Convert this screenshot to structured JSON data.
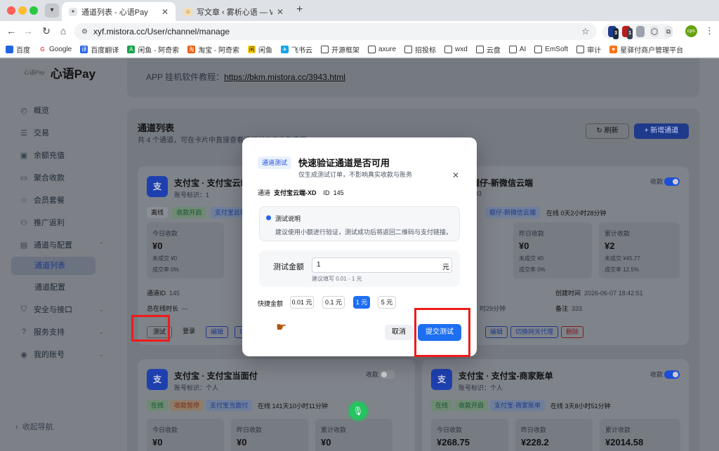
{
  "browser": {
    "tabs": [
      {
        "title": "通道列表 - 心语Pay",
        "active": true
      },
      {
        "title": "写文章 ‹ 雾析心语 — WordPress",
        "active": false
      }
    ],
    "url": "xyf.mistora.cc/User/channel/manage",
    "bookmarks": [
      "百度",
      "Google",
      "百度翻译",
      "闲鱼 - 阿奇索",
      "淘宝 - 阿奇索",
      "闲鱼",
      "飞书云",
      "开源框架",
      "axure",
      "招投标",
      "wxd",
      "云盘",
      "AI",
      "EmSoft",
      "审计",
      "星驿付商户管理平台"
    ],
    "ext_badges": [
      "3",
      "1"
    ]
  },
  "sidebar": {
    "logo": "心语Pay",
    "logo_small": "心语Pay",
    "items": [
      {
        "label": "概览",
        "icon": "dashboard-icon"
      },
      {
        "label": "交易",
        "icon": "list-icon"
      },
      {
        "label": "余额充值",
        "icon": "wallet-icon"
      },
      {
        "label": "聚合收款",
        "icon": "card-icon"
      },
      {
        "label": "会员套餐",
        "icon": "star-icon"
      },
      {
        "label": "推广返利",
        "icon": "users-icon"
      },
      {
        "label": "通道与配置",
        "icon": "channel-icon"
      },
      {
        "label": "安全与接口",
        "icon": "shield-icon"
      },
      {
        "label": "服务支持",
        "icon": "help-icon"
      },
      {
        "label": "我的账号",
        "icon": "user-icon"
      }
    ],
    "sub": [
      "通道列表",
      "通道配置"
    ],
    "collapse": "收起导航"
  },
  "page": {
    "tutorial_label": "APP 挂机软件教程：",
    "tutorial_link": "https://bkm.mistora.cc/3943.html",
    "list_title": "通道列表",
    "list_sub": "共 4 个通道，可在卡片中直接查看运行状态与收款表现",
    "refresh": "刷新",
    "add": "+ 新增通道",
    "cards": [
      {
        "avatar": "支",
        "title": "支付宝 · 支付宝云端",
        "account": "账号标识：1",
        "status": "离线",
        "collect": "收款开启",
        "tag": "支付宝云端",
        "today_label": "今日收款",
        "today": "¥0",
        "unpaid": "未成交 ¥0",
        "rate": "成交率 0%",
        "id_label": "通道ID",
        "id": "145",
        "online_label": "总在线时长",
        "online": "---",
        "actions": [
          "测试",
          "登录",
          "编辑",
          "切换"
        ]
      },
      {
        "title": "靓仔-新微信云端",
        "account": "333",
        "collect_label": "收款",
        "tag": "靓仔-新微信云端",
        "online": "在线 0天2小时28分钟",
        "y_label": "昨日收款",
        "y": "¥0",
        "y_unpaid": "未成交 ¥0",
        "y_rate": "成交率 0%",
        "t_label": "累计收款",
        "t": "¥2",
        "t_unpaid": "未成交 ¥45.77",
        "t_rate": "成交率 12.5%",
        "created_label": "创建时间",
        "created": "2026-06-07 18:42:51",
        "dur": "时29分钟",
        "remark_label": "备注",
        "remark": "333",
        "actions": [
          "编辑",
          "切换网关代理",
          "删除"
        ]
      },
      {
        "avatar": "支",
        "title": "支付宝 · 支付宝当面付",
        "account": "账号标识：个人",
        "collect_label": "收款",
        "status": "在线",
        "collect": "收款暂停",
        "tag": "支付宝当面付",
        "online": "在线 141天10小时11分钟",
        "today_label": "今日收款",
        "today": "¥0",
        "y_label": "昨日收款",
        "y": "¥0",
        "t_label": "累计收款",
        "t": "¥0"
      },
      {
        "avatar": "支",
        "title": "支付宝 · 支付宝-商家账单",
        "account": "账号标识：个人",
        "collect_label": "收款",
        "status": "在线",
        "collect": "收款开启",
        "tag": "支付宝-商家账单",
        "online": "在线 3天8小时51分钟",
        "today_label": "今日收款",
        "today": "¥268.75",
        "y_label": "昨日收款",
        "y": "¥228.2",
        "t_label": "累计收款",
        "t": "¥2014.58"
      }
    ]
  },
  "modal": {
    "tag": "通道测试",
    "title": "快速验证通道是否可用",
    "subtitle": "仅生成测试订单，不影响真实收款与账务",
    "channel_label": "通道",
    "channel_name": "支付宝云端-XD",
    "id_label": "ID",
    "id": "145",
    "note_title": "测试说明",
    "note_body": "建议使用小额进行验证，测试成功后将返回二维码与支付链接。",
    "amount_label": "测试金额",
    "amount_value": "1",
    "amount_unit": "元",
    "amount_hint": "建议填写 0.01 - 1 元",
    "quick_label": "快捷金额",
    "quick": [
      "0.01 元",
      "0.1 元",
      "1 元",
      "5 元"
    ],
    "quick_selected": 2,
    "cancel": "取消",
    "submit": "提交测试"
  },
  "colors": {
    "accent": "#1d6ff2",
    "highlight": "#ee1c1c",
    "mic": "#22c55e"
  }
}
